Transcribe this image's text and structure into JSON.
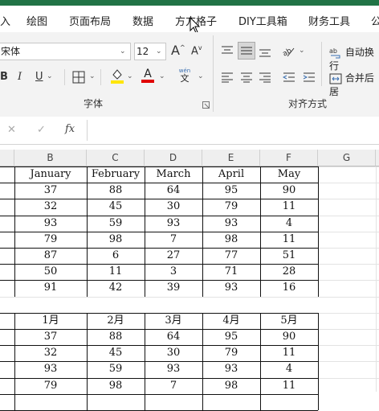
{
  "ribbon_tabs": [
    "入",
    "绘图",
    "页面布局",
    "数据",
    "方方格子",
    "DIY工具箱",
    "财务工具",
    "公"
  ],
  "font": {
    "name": "宋体",
    "size": "12",
    "grow_label": "A",
    "shrink_label": "A",
    "bold": "B",
    "italic": "I",
    "underline": "U",
    "fill_letter": "",
    "font_color_letter": "A",
    "phonetic_top": "wén",
    "phonetic_bottom": "文",
    "group_label": "字体"
  },
  "alignment": {
    "wrap_label": "自动换行",
    "merge_label": "合并后居",
    "group_label": "对齐方式"
  },
  "formula_bar": {
    "fx": "fx",
    "cancel": "✕",
    "confirm": "✓",
    "value": ""
  },
  "columns": [
    "B",
    "C",
    "D",
    "E",
    "F",
    "G"
  ],
  "table1": {
    "headers": [
      "January",
      "February",
      "March",
      "April",
      "May"
    ],
    "rows": [
      [
        "37",
        "88",
        "64",
        "95",
        "90"
      ],
      [
        "32",
        "45",
        "30",
        "79",
        "11"
      ],
      [
        "93",
        "59",
        "93",
        "93",
        "4"
      ],
      [
        "79",
        "98",
        "7",
        "98",
        "11"
      ],
      [
        "87",
        "6",
        "27",
        "77",
        "51"
      ],
      [
        "50",
        "11",
        "3",
        "71",
        "28"
      ],
      [
        "91",
        "42",
        "39",
        "93",
        "16"
      ]
    ]
  },
  "table2": {
    "headers": [
      "1月",
      "2月",
      "3月",
      "4月",
      "5月"
    ],
    "rows": [
      [
        "37",
        "88",
        "64",
        "95",
        "90"
      ],
      [
        "32",
        "45",
        "30",
        "79",
        "11"
      ],
      [
        "93",
        "59",
        "93",
        "93",
        "4"
      ],
      [
        "79",
        "98",
        "7",
        "98",
        "11"
      ]
    ]
  },
  "colors": {
    "green": "#217346",
    "fill_yellow": "#ffe600",
    "font_red": "#e00000"
  }
}
